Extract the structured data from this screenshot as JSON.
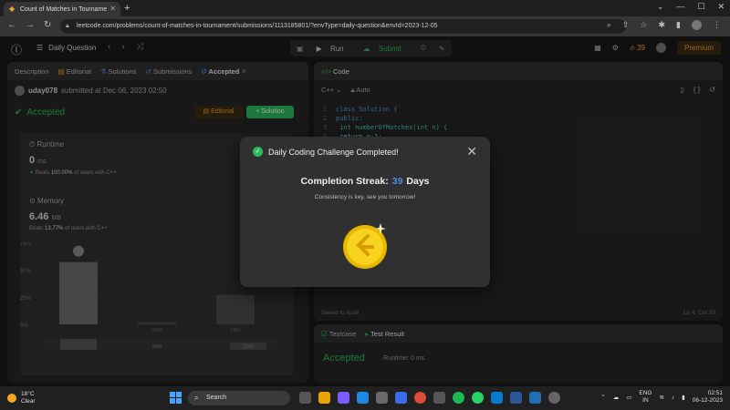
{
  "browser": {
    "tab_title": "Count of Matches in Tourname",
    "url": "leetcode.com/problems/count-of-matches-in-tournament/submissions/1113185801/?envType=daily-question&envId=2023-12-05"
  },
  "header": {
    "title": "Daily Question",
    "run_label": "Run",
    "submit_label": "Submit",
    "streak_count": "39",
    "premium_label": "Premium"
  },
  "left_panel": {
    "tabs": [
      "Description",
      "Editorial",
      "Solutions",
      "Submissions",
      "Accepted"
    ],
    "user": "uday078",
    "submitted_text": "submitted at Dec 06, 2023 02:50",
    "status": "Accepted",
    "editorial_btn": "Editorial",
    "solution_btn": "Solution",
    "runtime_label": "Runtime",
    "runtime_value": "0",
    "runtime_unit": "ms",
    "runtime_beats_prefix": "Beats",
    "runtime_beats": "100.00%",
    "runtime_beats_suffix": "of users with C++",
    "memory_label": "Memory",
    "memory_value": "6.46",
    "memory_unit": "MB",
    "memory_beats_prefix": "Beats",
    "memory_beats": "13.77%",
    "memory_beats_suffix": "of users with C++"
  },
  "chart_data": {
    "type": "bar",
    "yticks": [
      "75%",
      "50%",
      "25%",
      "0%"
    ],
    "categories": [
      "",
      "1ms",
      "2ms"
    ],
    "values": [
      57,
      2,
      27
    ],
    "ylim": [
      0,
      75
    ],
    "lower_categories": [
      "1ms",
      "2ms"
    ]
  },
  "code_panel": {
    "title": "Code",
    "language": "C++",
    "mode": "Auto",
    "lines": [
      {
        "n": "1",
        "text": "class Solution {"
      },
      {
        "n": "2",
        "text": "public:"
      },
      {
        "n": "3",
        "text": "    int numberOfMatches(int n) {"
      },
      {
        "n": "4",
        "text": "        return n-1;"
      }
    ],
    "saved": "Saved to local",
    "cursor": "Ln 4, Col 20"
  },
  "test_panel": {
    "tab1": "Testcase",
    "tab2": "Test Result",
    "status": "Accepted",
    "runtime": "Runtime: 0 ms"
  },
  "modal": {
    "title": "Daily Coding Challenge Completed!",
    "streak_prefix": "Completion Streak:",
    "streak_num": "39",
    "streak_suffix": "Days",
    "message": "Consistency is key, see you tomorrow!"
  },
  "taskbar": {
    "temp": "18°C",
    "weather": "Clear",
    "search": "Search",
    "lang1": "ENG",
    "lang2": "IN",
    "time": "02:51",
    "date": "06-12-2023"
  }
}
